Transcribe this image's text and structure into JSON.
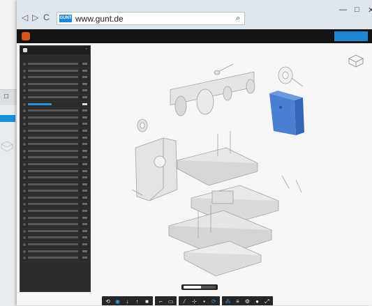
{
  "browser": {
    "url": "www.gunt.de",
    "favicon_text": "GUNT",
    "nav": {
      "back": "◁",
      "forward": "▷",
      "reload": "C"
    },
    "search_icon": "⌕",
    "window_controls": {
      "minimize": "—",
      "maximize": "□",
      "close": "✕"
    }
  },
  "background_window": {
    "control": "□"
  },
  "app": {
    "icons": [
      "logo-icon"
    ],
    "title": "",
    "action_label": ""
  },
  "panel": {
    "title": "",
    "close": "×",
    "subtitle": "",
    "rows": 30,
    "selected_row": 6
  },
  "viewer": {
    "progress": 0.55,
    "accent_color": "#4a7fd1",
    "toolbar_groups": [
      [
        {
          "icon": "cube-rotate-icon",
          "glyph": "⟲",
          "active": false
        },
        {
          "icon": "target-icon",
          "glyph": "◉",
          "active": true
        },
        {
          "icon": "pan-down-icon",
          "glyph": "↓",
          "active": false
        },
        {
          "icon": "pan-up-icon",
          "glyph": "↑",
          "active": false
        },
        {
          "icon": "camera-icon",
          "glyph": "■",
          "active": false
        }
      ],
      [
        {
          "icon": "fit-icon",
          "glyph": "⌐",
          "active": false
        },
        {
          "icon": "section-icon",
          "glyph": "▭",
          "active": false
        }
      ],
      [
        {
          "icon": "measure-icon",
          "glyph": "⁄",
          "active": false
        },
        {
          "icon": "explode-icon",
          "glyph": "⊹",
          "active": false
        },
        {
          "icon": "box-icon",
          "glyph": "▪",
          "active": false
        },
        {
          "icon": "orbit-icon",
          "glyph": "⟳",
          "active": true
        }
      ],
      [
        {
          "icon": "tree-icon",
          "glyph": "⁂",
          "active": true
        },
        {
          "icon": "layers-icon",
          "glyph": "≡",
          "active": false
        },
        {
          "icon": "settings-icon",
          "glyph": "⚙",
          "active": false
        },
        {
          "icon": "info-icon",
          "glyph": "●",
          "active": false
        },
        {
          "icon": "fullscreen-icon",
          "glyph": "⤢",
          "active": false
        }
      ]
    ]
  }
}
